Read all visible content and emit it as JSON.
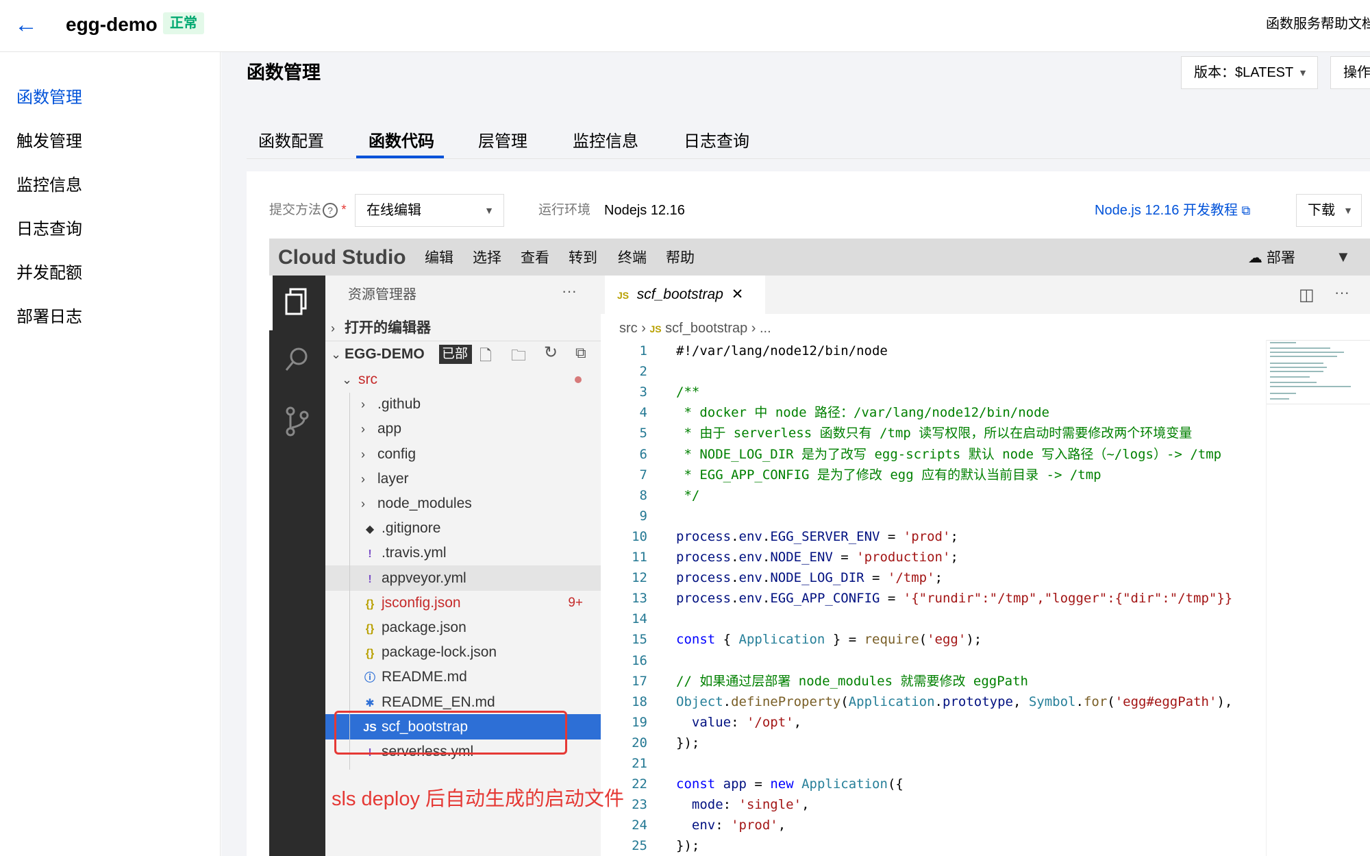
{
  "header": {
    "back_label": "←",
    "app_name": "egg-demo",
    "status": "正常",
    "help_doc": "函数服务帮助文档"
  },
  "sidebar": {
    "items": [
      {
        "label": "函数管理",
        "active": true
      },
      {
        "label": "触发管理",
        "active": false
      },
      {
        "label": "监控信息",
        "active": false
      },
      {
        "label": "日志查询",
        "active": false
      },
      {
        "label": "并发配额",
        "active": false
      },
      {
        "label": "部署日志",
        "active": false
      }
    ]
  },
  "page": {
    "title": "函数管理",
    "version_label": "版本：$LATEST",
    "ops_label": "操作"
  },
  "tabs": [
    {
      "label": "函数配置",
      "active": false
    },
    {
      "label": "函数代码",
      "active": true
    },
    {
      "label": "层管理",
      "active": false
    },
    {
      "label": "监控信息",
      "active": false
    },
    {
      "label": "日志查询",
      "active": false
    }
  ],
  "form": {
    "submit_label": "提交方法",
    "submit_value": "在线编辑",
    "runtime_label": "运行环境",
    "runtime_value": "Nodejs 12.16",
    "tutorial_link": "Node.js 12.16 开发教程",
    "download_label": "下载"
  },
  "ide": {
    "brand": "Cloud Studio",
    "menu": [
      "编辑",
      "选择",
      "查看",
      "转到",
      "终端",
      "帮助"
    ],
    "deploy_label": "部署",
    "explorer_title": "资源管理器",
    "open_editors": "打开的编辑器",
    "project": "EGG-DEMO",
    "project_badge": "已部",
    "tree": [
      {
        "label": "src",
        "type": "folder-open",
        "indent": 0,
        "color": "#c52a2a"
      },
      {
        "label": ".github",
        "type": "folder",
        "indent": 1
      },
      {
        "label": "app",
        "type": "folder",
        "indent": 1
      },
      {
        "label": "config",
        "type": "folder",
        "indent": 1
      },
      {
        "label": "layer",
        "type": "folder",
        "indent": 1
      },
      {
        "label": "node_modules",
        "type": "folder",
        "indent": 1
      },
      {
        "label": ".gitignore",
        "type": "git",
        "indent": 1
      },
      {
        "label": ".travis.yml",
        "type": "yml",
        "indent": 1
      },
      {
        "label": "appveyor.yml",
        "type": "yml",
        "indent": 1
      },
      {
        "label": "jsconfig.json",
        "type": "json",
        "indent": 1,
        "color": "#c52a2a",
        "badge": "9+"
      },
      {
        "label": "package.json",
        "type": "json",
        "indent": 1
      },
      {
        "label": "package-lock.json",
        "type": "json",
        "indent": 1
      },
      {
        "label": "README.md",
        "type": "info",
        "indent": 1
      },
      {
        "label": "README_EN.md",
        "type": "md",
        "indent": 1
      },
      {
        "label": "scf_bootstrap",
        "type": "js",
        "indent": 1,
        "selected": true
      },
      {
        "label": "serverless.yml",
        "type": "yml",
        "indent": 1
      }
    ],
    "editor_tab": "scf_bootstrap",
    "breadcrumb": {
      "folder": "src",
      "file": "scf_bootstrap",
      "more": "..."
    },
    "code": [
      {
        "n": "1",
        "t": [
          [
            "",
            "#!/var/lang/node12/bin/node"
          ]
        ]
      },
      {
        "n": "2",
        "t": []
      },
      {
        "n": "3",
        "t": [
          [
            "com",
            "/**"
          ]
        ]
      },
      {
        "n": "4",
        "t": [
          [
            "com",
            " * docker 中 node 路径：/var/lang/node12/bin/node"
          ]
        ]
      },
      {
        "n": "5",
        "t": [
          [
            "com",
            " * 由于 serverless 函数只有 /tmp 读写权限，所以在启动时需要修改两个环境变量"
          ]
        ]
      },
      {
        "n": "6",
        "t": [
          [
            "com",
            " * NODE_LOG_DIR 是为了改写 egg-scripts 默认 node 写入路径（~/logs）-> /tmp"
          ]
        ]
      },
      {
        "n": "7",
        "t": [
          [
            "com",
            " * EGG_APP_CONFIG 是为了修改 egg 应有的默认当前目录 -> /tmp"
          ]
        ]
      },
      {
        "n": "8",
        "t": [
          [
            "com",
            " */"
          ]
        ]
      },
      {
        "n": "9",
        "t": []
      },
      {
        "n": "10",
        "t": [
          [
            "prop",
            "process"
          ],
          [
            "",
            "."
          ],
          [
            "prop",
            "env"
          ],
          [
            "",
            "."
          ],
          [
            "prop",
            "EGG_SERVER_ENV"
          ],
          [
            "",
            " = "
          ],
          [
            "str",
            "'prod'"
          ],
          [
            "",
            ";"
          ]
        ]
      },
      {
        "n": "11",
        "t": [
          [
            "prop",
            "process"
          ],
          [
            "",
            "."
          ],
          [
            "prop",
            "env"
          ],
          [
            "",
            "."
          ],
          [
            "prop",
            "NODE_ENV"
          ],
          [
            "",
            " = "
          ],
          [
            "str",
            "'production'"
          ],
          [
            "",
            ";"
          ]
        ]
      },
      {
        "n": "12",
        "t": [
          [
            "prop",
            "process"
          ],
          [
            "",
            "."
          ],
          [
            "prop",
            "env"
          ],
          [
            "",
            "."
          ],
          [
            "prop",
            "NODE_LOG_DIR"
          ],
          [
            "",
            " = "
          ],
          [
            "str",
            "'/tmp'"
          ],
          [
            "",
            ";"
          ]
        ]
      },
      {
        "n": "13",
        "t": [
          [
            "prop",
            "process"
          ],
          [
            "",
            "."
          ],
          [
            "prop",
            "env"
          ],
          [
            "",
            "."
          ],
          [
            "prop",
            "EGG_APP_CONFIG"
          ],
          [
            "",
            " = "
          ],
          [
            "str",
            "'{\"rundir\":\"/tmp\",\"logger\":{\"dir\":\"/tmp\"}}"
          ]
        ]
      },
      {
        "n": "14",
        "t": []
      },
      {
        "n": "15",
        "t": [
          [
            "kw",
            "const"
          ],
          [
            "",
            " { "
          ],
          [
            "cls",
            "Application"
          ],
          [
            "",
            " } = "
          ],
          [
            "fn",
            "require"
          ],
          [
            "",
            "("
          ],
          [
            "str",
            "'egg'"
          ],
          [
            "",
            ");"
          ]
        ]
      },
      {
        "n": "16",
        "t": []
      },
      {
        "n": "17",
        "t": [
          [
            "com",
            "// 如果通过层部署 node_modules 就需要修改 eggPath"
          ]
        ]
      },
      {
        "n": "18",
        "t": [
          [
            "cls",
            "Object"
          ],
          [
            "",
            "."
          ],
          [
            "fn",
            "defineProperty"
          ],
          [
            "",
            "("
          ],
          [
            "cls",
            "Application"
          ],
          [
            "",
            "."
          ],
          [
            "prop",
            "prototype"
          ],
          [
            "",
            ", "
          ],
          [
            "cls",
            "Symbol"
          ],
          [
            "",
            "."
          ],
          [
            "fn",
            "for"
          ],
          [
            "",
            "("
          ],
          [
            "str",
            "'egg#eggPath'"
          ],
          [
            "",
            "),"
          ]
        ]
      },
      {
        "n": "19",
        "t": [
          [
            "",
            "  "
          ],
          [
            "prop",
            "value"
          ],
          [
            "",
            ": "
          ],
          [
            "str",
            "'/opt'"
          ],
          [
            "",
            ","
          ]
        ]
      },
      {
        "n": "20",
        "t": [
          [
            "",
            "});"
          ]
        ]
      },
      {
        "n": "21",
        "t": []
      },
      {
        "n": "22",
        "t": [
          [
            "kw",
            "const"
          ],
          [
            "",
            " "
          ],
          [
            "prop",
            "app"
          ],
          [
            "",
            " = "
          ],
          [
            "kw",
            "new"
          ],
          [
            "",
            " "
          ],
          [
            "cls",
            "Application"
          ],
          [
            "",
            "({"
          ]
        ]
      },
      {
        "n": "23",
        "t": [
          [
            "",
            "  "
          ],
          [
            "prop",
            "mode"
          ],
          [
            "",
            ": "
          ],
          [
            "str",
            "'single'"
          ],
          [
            "",
            ","
          ]
        ]
      },
      {
        "n": "24",
        "t": [
          [
            "",
            "  "
          ],
          [
            "prop",
            "env"
          ],
          [
            "",
            ": "
          ],
          [
            "str",
            "'prod'"
          ],
          [
            "",
            ","
          ]
        ]
      },
      {
        "n": "25",
        "t": [
          [
            "",
            "});"
          ]
        ]
      }
    ]
  },
  "annotation": "sls deploy 后自动生成的启动文件"
}
